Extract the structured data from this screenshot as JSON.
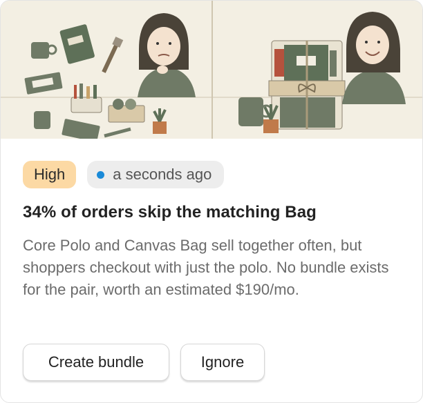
{
  "card": {
    "priority_label": "High",
    "time_label": "a seconds ago",
    "title": "34% of orders skip the matching Bag",
    "description": "Core Polo and Canvas Bag sell together often, but shoppers checkout with just the polo. No bundle exists for the pair, worth an estimated $190/mo.",
    "actions": {
      "primary": "Create bundle",
      "secondary": "Ignore"
    }
  },
  "colors": {
    "priority_bg": "#fcd9a4",
    "status_dot": "#1a8ad8",
    "hero_bg": "#f3efe3"
  }
}
